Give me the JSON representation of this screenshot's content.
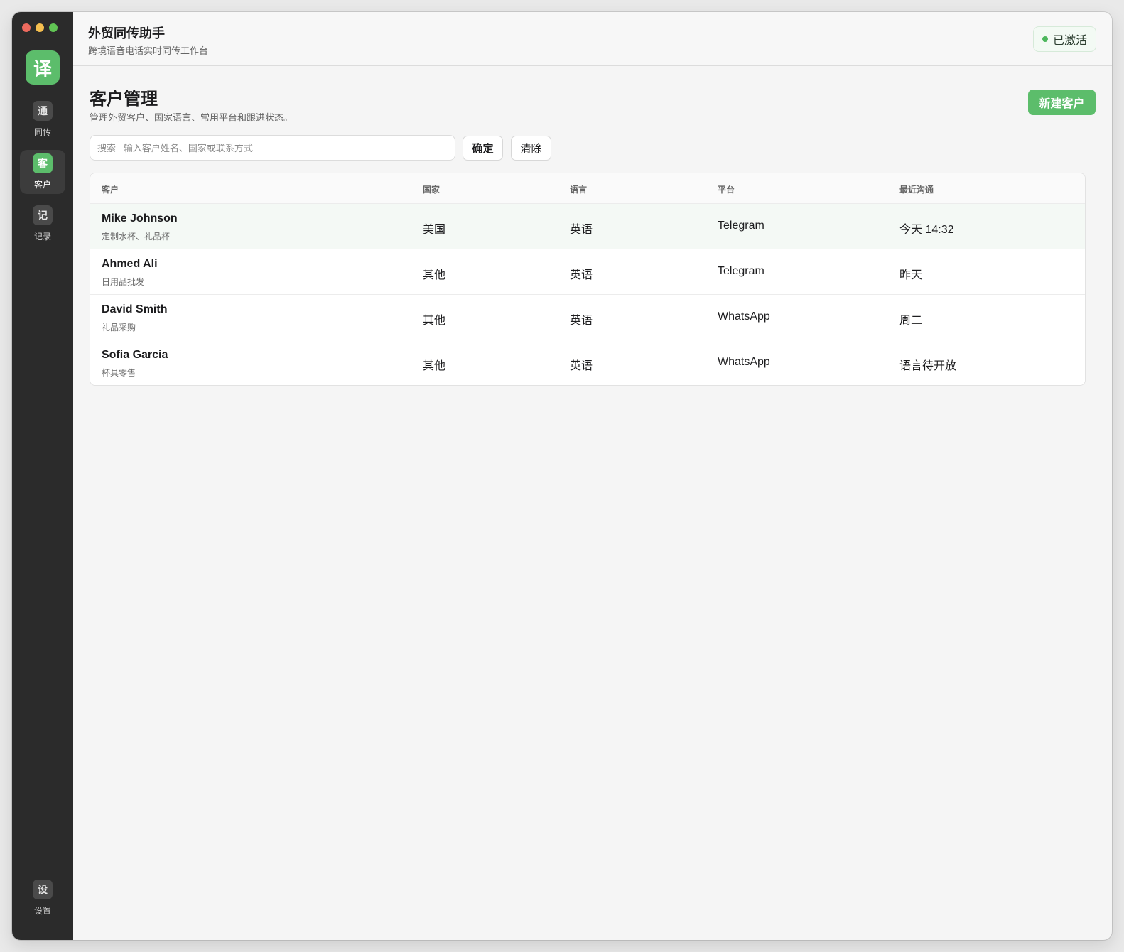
{
  "sidebar": {
    "logo_glyph": "译",
    "nav": [
      {
        "icon": "通",
        "label": "同传"
      },
      {
        "icon": "客",
        "label": "客户"
      },
      {
        "icon": "记",
        "label": "记录"
      }
    ],
    "settings": {
      "icon": "设",
      "label": "设置"
    }
  },
  "header": {
    "title": "外贸同传助手",
    "subtitle": "跨境语音电话实时同传工作台",
    "status": "已激活"
  },
  "page": {
    "title": "客户管理",
    "subtitle": "管理外贸客户、国家语言、常用平台和跟进状态。",
    "new_button": "新建客户"
  },
  "search": {
    "placeholder": "搜索   输入客户姓名、国家或联系方式",
    "confirm_label": "确定",
    "clear_label": "清除"
  },
  "table": {
    "headers": [
      "客户",
      "国家",
      "语言",
      "平台",
      "最近沟通"
    ],
    "rows": [
      {
        "name": "Mike Johnson",
        "note": "定制水杯、礼品杯",
        "country": "美国",
        "language": "英语",
        "platform": "Telegram",
        "last_contact": "今天 14:32"
      },
      {
        "name": "Ahmed Ali",
        "note": "日用品批发",
        "country": "其他",
        "language": "英语",
        "platform": "Telegram",
        "last_contact": "昨天"
      },
      {
        "name": "David Smith",
        "note": "礼品采购",
        "country": "其他",
        "language": "英语",
        "platform": "WhatsApp",
        "last_contact": "周二"
      },
      {
        "name": "Sofia Garcia",
        "note": "杯具零售",
        "country": "其他",
        "language": "英语",
        "platform": "WhatsApp",
        "last_contact": "语言待开放"
      }
    ]
  },
  "colors": {
    "accent": "#5cbd6b",
    "sidebar_bg": "#2b2b2b",
    "content_bg": "#f5f5f5",
    "selected_row": "#f4f9f5"
  }
}
